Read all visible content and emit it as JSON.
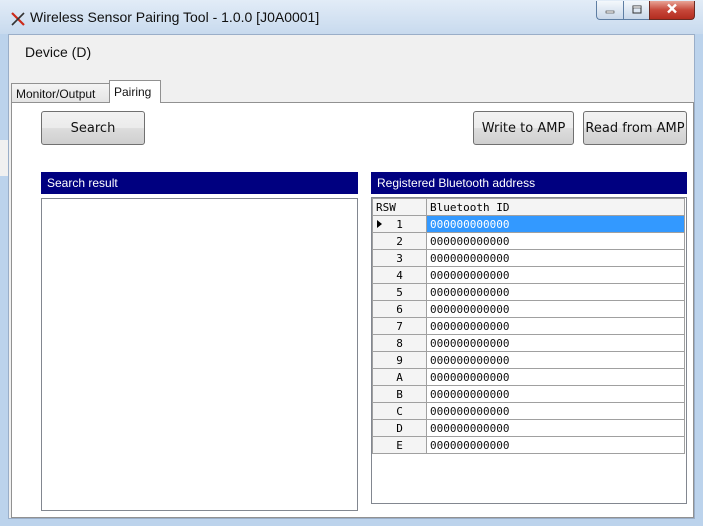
{
  "window": {
    "title": "Wireless Sensor Pairing Tool - 1.0.0 [J0A0001]"
  },
  "menu": {
    "device_label": "Device (D)"
  },
  "tabs": [
    {
      "label": "Monitor/Output",
      "active": false
    },
    {
      "label": "Pairing",
      "active": true
    }
  ],
  "buttons": {
    "search": "Search",
    "write_to_amp": "Write to AMP",
    "read_from_amp": "Read from AMP"
  },
  "search_result": {
    "header": "Search result",
    "items": []
  },
  "registered": {
    "header": "Registered Bluetooth address",
    "columns": [
      "RSW",
      "Bluetooth ID"
    ],
    "selected_index": 0,
    "rows": [
      {
        "rsw": "1",
        "id": "000000000000"
      },
      {
        "rsw": "2",
        "id": "000000000000"
      },
      {
        "rsw": "3",
        "id": "000000000000"
      },
      {
        "rsw": "4",
        "id": "000000000000"
      },
      {
        "rsw": "5",
        "id": "000000000000"
      },
      {
        "rsw": "6",
        "id": "000000000000"
      },
      {
        "rsw": "7",
        "id": "000000000000"
      },
      {
        "rsw": "8",
        "id": "000000000000"
      },
      {
        "rsw": "9",
        "id": "000000000000"
      },
      {
        "rsw": "A",
        "id": "000000000000"
      },
      {
        "rsw": "B",
        "id": "000000000000"
      },
      {
        "rsw": "C",
        "id": "000000000000"
      },
      {
        "rsw": "D",
        "id": "000000000000"
      },
      {
        "rsw": "E",
        "id": "000000000000"
      }
    ]
  },
  "colors": {
    "header_bg": "#000080",
    "selection": "#3399ff",
    "titlebar": "#c8daee"
  },
  "icons": {
    "app": "wireless-tool-icon",
    "minimize": "minimize-icon",
    "maximize": "maximize-icon",
    "close": "close-icon",
    "row_pointer": "row-pointer-icon"
  }
}
